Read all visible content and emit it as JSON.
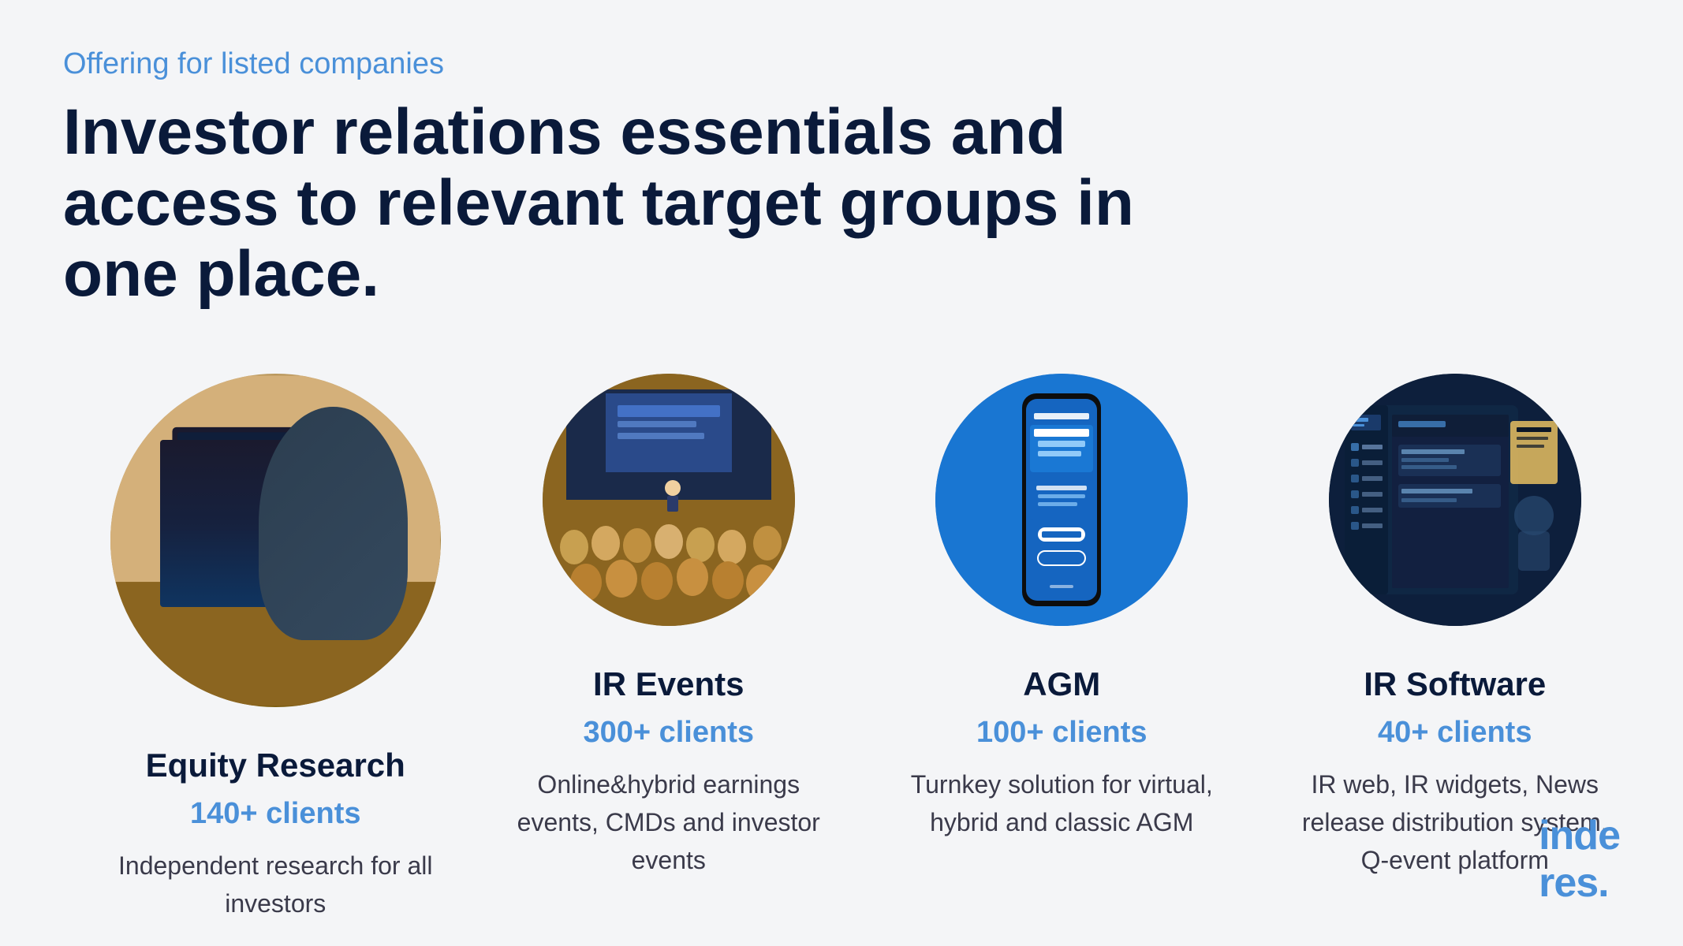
{
  "header": {
    "subtitle": "Offering for listed companies",
    "title": "Investor relations essentials and access to relevant target groups in one place."
  },
  "cards": [
    {
      "id": "equity-research",
      "image_type": "equity",
      "title": "Equity Research",
      "clients": "140+ clients",
      "description": "Independent research for all investors"
    },
    {
      "id": "ir-events",
      "image_type": "events",
      "title": "IR Events",
      "clients": "300+ clients",
      "description": "Online&hybrid earnings events, CMDs and investor events"
    },
    {
      "id": "agm",
      "image_type": "agm",
      "title": "AGM",
      "clients": "100+ clients",
      "description": "Turnkey solution for virtual, hybrid and classic AGM"
    },
    {
      "id": "ir-software",
      "image_type": "software",
      "title": "IR Software",
      "clients": "40+ clients",
      "description": "IR web, IR widgets, News release distribution system, Q-event platform"
    }
  ],
  "logo": {
    "text_main": "inde",
    "text_accent": "res."
  },
  "colors": {
    "accent_blue": "#4a90d9",
    "dark_navy": "#0a1a3a",
    "body_text": "#3a3a4a",
    "background": "#f4f5f7"
  }
}
